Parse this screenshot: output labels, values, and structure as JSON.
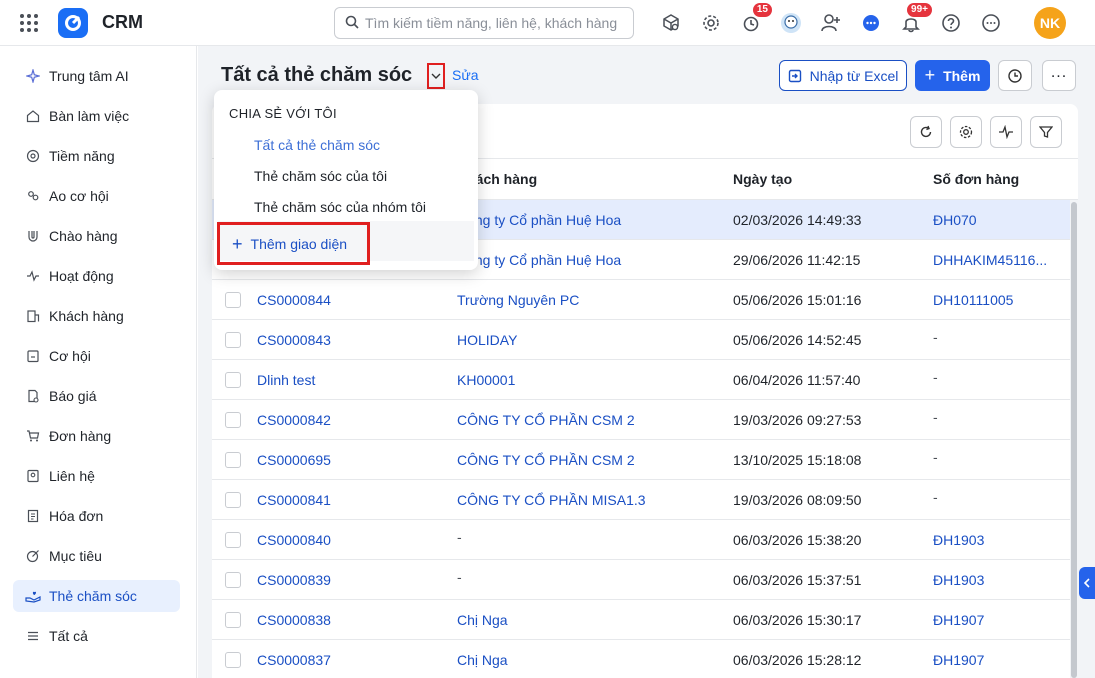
{
  "app": {
    "title": "CRM",
    "avatar_initials": "NK"
  },
  "search": {
    "placeholder": "Tìm kiếm tiềm năng, liên hệ, khách hàng"
  },
  "top_icons": [
    {
      "name": "cube-search-icon"
    },
    {
      "name": "gear-icon"
    },
    {
      "name": "alarm-clock-icon",
      "badge": "15"
    },
    {
      "name": "mascot-icon"
    },
    {
      "name": "add-user-icon"
    },
    {
      "name": "chat-icon"
    },
    {
      "name": "bell-icon",
      "badge": "99+"
    },
    {
      "name": "help-icon"
    },
    {
      "name": "more-icon"
    }
  ],
  "sidebar": {
    "items": [
      {
        "label": "Trung tâm AI",
        "icon": "sparkle-icon"
      },
      {
        "label": "Bàn làm việc",
        "icon": "home-icon"
      },
      {
        "label": "Tiềm năng",
        "icon": "target-icon"
      },
      {
        "label": "Ao cơ hội",
        "icon": "people-icon"
      },
      {
        "label": "Chào hàng",
        "icon": "magnet-icon"
      },
      {
        "label": "Hoạt động",
        "icon": "pulse-icon"
      },
      {
        "label": "Khách hàng",
        "icon": "building-icon"
      },
      {
        "label": "Cơ hội",
        "icon": "folder-icon"
      },
      {
        "label": "Báo giá",
        "icon": "quote-doc-icon"
      },
      {
        "label": "Đơn hàng",
        "icon": "cart-icon"
      },
      {
        "label": "Liên hệ",
        "icon": "contact-icon"
      },
      {
        "label": "Hóa đơn",
        "icon": "invoice-icon"
      },
      {
        "label": "Mục tiêu",
        "icon": "goal-icon"
      },
      {
        "label": "Thẻ chăm sóc",
        "icon": "care-icon",
        "active": true
      },
      {
        "label": "Tất cả",
        "icon": "list-icon"
      }
    ]
  },
  "header": {
    "title": "Tất cả thẻ chăm sóc",
    "edit_label": "Sửa",
    "import_label": "Nhập từ Excel",
    "add_label": "Thêm"
  },
  "dropdown": {
    "heading": "CHIA SẺ VỚI TÔI",
    "items": [
      {
        "label": "Tất cả thẻ chăm sóc",
        "selected": true
      },
      {
        "label": "Thẻ chăm sóc của tôi"
      },
      {
        "label": "Thẻ chăm sóc của nhóm tôi"
      }
    ],
    "add_label": "Thêm giao diện"
  },
  "table": {
    "columns": [
      "Khách hàng",
      "Ngày tạo",
      "Số đơn hàng"
    ],
    "rows": [
      {
        "code": "",
        "customer": "Công ty Cổ phần Huệ Hoa",
        "date": "02/03/2026 14:49:33",
        "order": "ĐH070",
        "highlight": true
      },
      {
        "code": "",
        "customer": "Công ty Cổ phần Huệ Hoa",
        "date": "29/06/2026 11:42:15",
        "order": "DHHAKIM45116..."
      },
      {
        "code": "CS0000844",
        "customer": "Trường Nguyên PC",
        "date": "05/06/2026 15:01:16",
        "order": "DH10111005"
      },
      {
        "code": "CS0000843",
        "customer": "HOLIDAY",
        "date": "05/06/2026 14:52:45",
        "order": "-"
      },
      {
        "code": "Dlinh test",
        "customer": "KH00001",
        "date": "06/04/2026 11:57:40",
        "order": "-"
      },
      {
        "code": "CS0000842",
        "customer": "CÔNG TY CỔ PHẦN CSM 2",
        "date": "19/03/2026 09:27:53",
        "order": "-"
      },
      {
        "code": "CS0000695",
        "customer": "CÔNG TY CỔ PHẦN CSM 2",
        "date": "13/10/2025 15:18:08",
        "order": "-"
      },
      {
        "code": "CS0000841",
        "customer": "CÔNG TY CỔ PHẦN MISA1.3",
        "date": "19/03/2026 08:09:50",
        "order": "-"
      },
      {
        "code": "CS0000840",
        "customer": "-",
        "date": "06/03/2026 15:38:20",
        "order": "ĐH1903"
      },
      {
        "code": "CS0000839",
        "customer": "-",
        "date": "06/03/2026 15:37:51",
        "order": "ĐH1903"
      },
      {
        "code": "CS0000838",
        "customer": "Chị Nga",
        "date": "06/03/2026 15:30:17",
        "order": "ĐH1907"
      },
      {
        "code": "CS0000837",
        "customer": "Chị Nga",
        "date": "06/03/2026 15:28:12",
        "order": "ĐH1907"
      }
    ]
  },
  "colors": {
    "accent": "#2563eb",
    "link": "#1a4fc4",
    "highlight": "#e01f1f"
  }
}
